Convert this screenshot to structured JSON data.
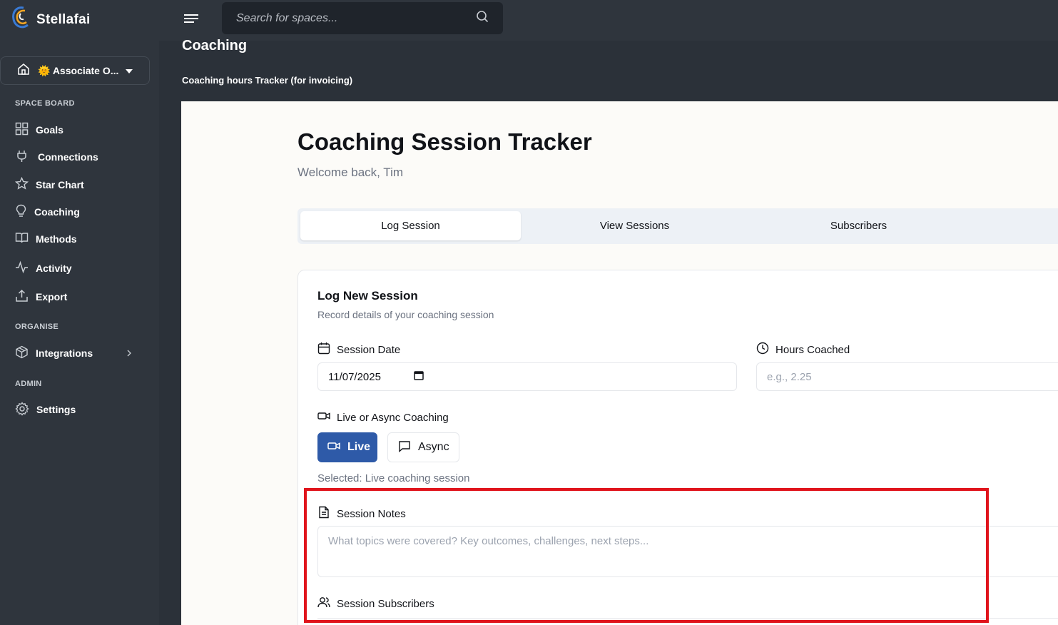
{
  "app": {
    "name": "Stellafai",
    "search_placeholder": "Search for spaces..."
  },
  "sidebar": {
    "space_selector": {
      "icon": "home-icon",
      "emoji": "🌞",
      "label": "Associate O..."
    },
    "sections": [
      {
        "label": "SPACE BOARD"
      },
      {
        "label": "ORGANISE"
      },
      {
        "label": "ADMIN"
      }
    ],
    "items": [
      {
        "label": "Goals",
        "icon": "grid-icon"
      },
      {
        "label": "Connections",
        "icon": "plug-icon"
      },
      {
        "label": "Star Chart",
        "icon": "star-icon"
      },
      {
        "label": "Coaching",
        "icon": "lightbulb-icon"
      },
      {
        "label": "Methods",
        "icon": "book-icon"
      },
      {
        "label": "Activity",
        "icon": "activity-icon"
      },
      {
        "label": "Export",
        "icon": "upload-icon"
      },
      {
        "label": "Integrations",
        "icon": "box-icon"
      },
      {
        "label": "Settings",
        "icon": "gear-icon"
      }
    ]
  },
  "page": {
    "title": "Coaching",
    "subtitle": "Coaching hours Tracker (for invoicing)"
  },
  "tracker": {
    "title": "Coaching Session Tracker",
    "welcome": "Welcome back, Tim",
    "tabs": [
      {
        "label": "Log Session",
        "active": true
      },
      {
        "label": "View Sessions",
        "active": false
      },
      {
        "label": "Subscribers",
        "active": false
      }
    ],
    "form": {
      "title": "Log New Session",
      "description": "Record details of your coaching session",
      "session_date_label": "Session Date",
      "session_date_value": "11/07/2025",
      "hours_label": "Hours Coached",
      "hours_placeholder": "e.g., 2.25",
      "mode_label": "Live or Async Coaching",
      "live_label": "Live",
      "async_label": "Async",
      "selected_text": "Selected: Live coaching session",
      "notes_label": "Session Notes",
      "notes_placeholder": "What topics were covered? Key outcomes, challenges, next steps...",
      "subscribers_label": "Session Subscribers"
    }
  },
  "colors": {
    "accent": "#2e5aa8",
    "highlight": "#e0141c",
    "sidebar_bg": "#2f353d"
  }
}
